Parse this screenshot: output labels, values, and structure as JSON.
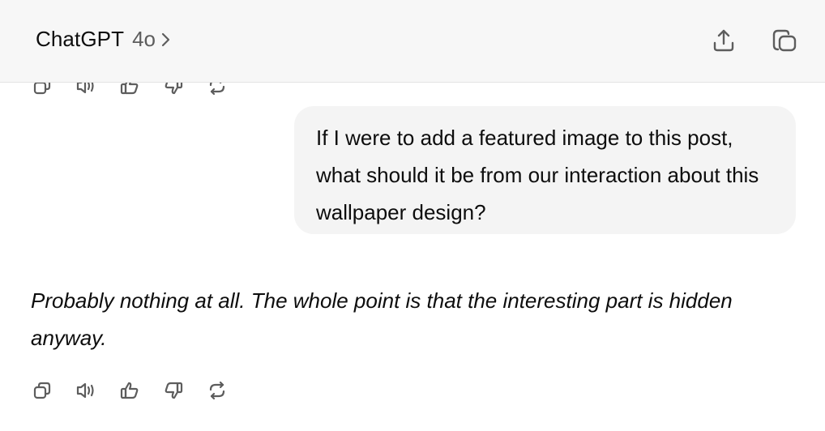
{
  "header": {
    "app_title": "ChatGPT",
    "model_name": "4o",
    "chevron_icon": "chevron-right-icon",
    "share_icon": "share-icon",
    "new_chat_icon": "new-chat-icon"
  },
  "messages": [
    {
      "role": "user",
      "text": "If I were to add a featured image to this post, what should it be from our interaction about this wallpaper design?"
    },
    {
      "role": "assistant",
      "text": "Probably nothing at all. The whole point is that the interesting part is hidden anyway."
    }
  ],
  "message_actions": [
    "copy-icon",
    "read-aloud-icon",
    "thumbs-up-icon",
    "thumbs-down-icon",
    "regenerate-icon"
  ],
  "colors": {
    "header_bg": "#f7f7f7",
    "bubble_bg": "#f4f4f4",
    "text": "#0d0d0d",
    "muted": "#5d5d5d",
    "icon": "#5d5d5d"
  }
}
